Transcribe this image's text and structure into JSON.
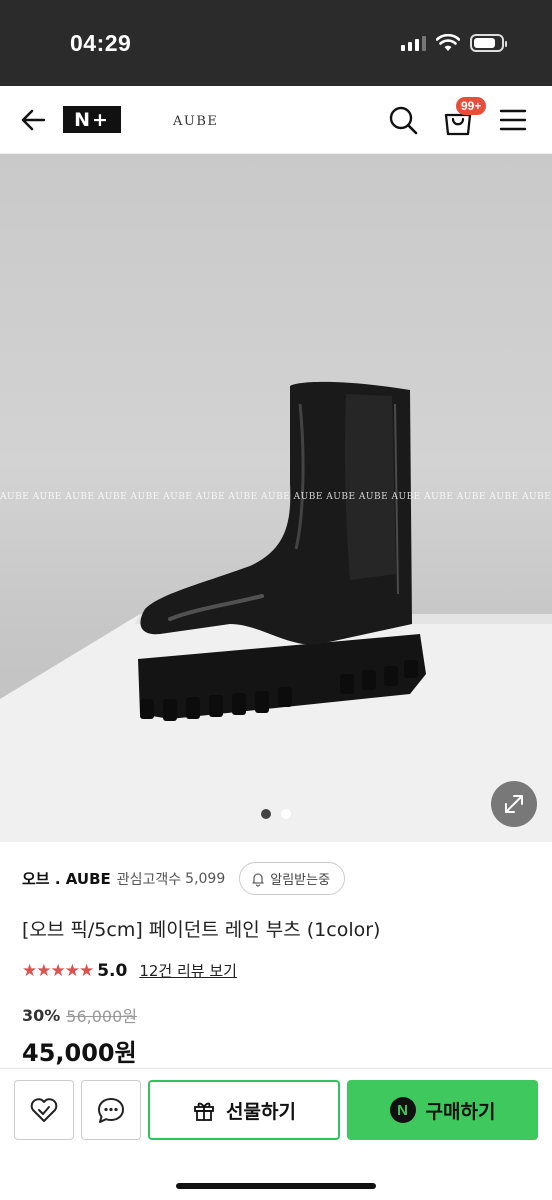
{
  "status_bar": {
    "time": "04:29",
    "icons": [
      "cellular-signal-icon",
      "wifi-icon",
      "battery-icon"
    ]
  },
  "header": {
    "back_icon": "arrow-left-icon",
    "logo_text": "N+",
    "brand_text": "AUBE",
    "search_icon": "search-icon",
    "cart_icon": "shopping-bag-icon",
    "cart_badge": "99+",
    "menu_icon": "hamburger-menu-icon"
  },
  "gallery": {
    "watermark": "AUBE AUBE AUBE AUBE AUBE AUBE AUBE AUBE AUBE AUBE AUBE AUBE AUBE AUBE AUBE AUBE AUBE AUBE AUBE AUBE AUBE AUBE AUBE AUBE AUBE AUBE AUBE",
    "total_images": 2,
    "current_index": 1,
    "expand_icon": "expand-arrows-icon"
  },
  "product": {
    "brand": "오브 . AUBE",
    "interest_label": "관심고객수",
    "interest_count": "5,099",
    "notify_label": "알림받는중",
    "title": "[오브 픽/5cm] 페이던트 레인 부츠 (1color)",
    "stars": "★★★★★",
    "rating": "5.0",
    "review_link": "12건 리뷰 보기",
    "discount_rate": "30%",
    "original_price": "56,000원",
    "sale_price": "45,000원"
  },
  "actions": {
    "wish_icon": "heart-check-icon",
    "chat_icon": "chat-bubble-icon",
    "gift_label": "선물하기",
    "gift_icon": "gift-icon",
    "buy_label": "구매하기",
    "npay_icon_text": "N"
  },
  "colors": {
    "accent_green": "#3ec85e",
    "badge_red": "#e94e3c",
    "star_red": "#d9544f"
  }
}
